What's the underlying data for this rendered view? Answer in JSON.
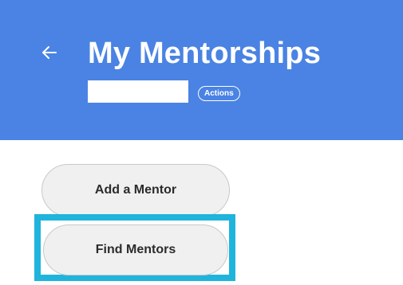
{
  "header": {
    "title": "My Mentorships",
    "actions_label": "Actions",
    "back_icon": "back-arrow-icon",
    "background_color": "#4a83e3"
  },
  "buttons": {
    "add_mentor_label": "Add a Mentor",
    "find_mentors_label": "Find Mentors"
  },
  "highlight": {
    "color": "#1fb4dc",
    "target": "Find Mentors"
  }
}
